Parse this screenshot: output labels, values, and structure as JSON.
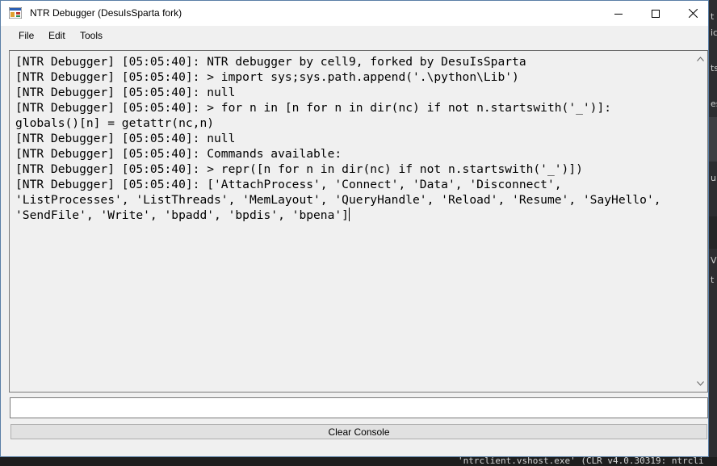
{
  "window": {
    "title": "NTR Debugger (DesuIsSparta fork)",
    "accent": "#5a7fa6"
  },
  "menu": {
    "items": [
      "File",
      "Edit",
      "Tools"
    ]
  },
  "console": {
    "text": "[NTR Debugger] [05:05:40]: NTR debugger by cell9, forked by DesuIsSparta\n[NTR Debugger] [05:05:40]: > import sys;sys.path.append('.\\python\\Lib')\n[NTR Debugger] [05:05:40]: null\n[NTR Debugger] [05:05:40]: > for n in [n for n in dir(nc) if not n.startswith('_')]:\nglobals()[n] = getattr(nc,n)\n[NTR Debugger] [05:05:40]: null\n[NTR Debugger] [05:05:40]: Commands available:\n[NTR Debugger] [05:05:40]: > repr([n for n in dir(nc) if not n.startswith('_')])\n[NTR Debugger] [05:05:40]: ['AttachProcess', 'Connect', 'Data', 'Disconnect',\n'ListProcesses', 'ListThreads', 'MemLayout', 'QueryHandle', 'Reload', 'Resume', 'SayHello',\n'SendFile', 'Write', 'bpadd', 'bpdis', 'bpena']"
  },
  "command_input": {
    "value": ""
  },
  "buttons": {
    "clear_console": "Clear Console"
  },
  "background": {
    "right_fragments": [
      "t",
      "ic",
      "ts",
      "es",
      "u",
      "V",
      "t"
    ],
    "bottom_text": "'ntrclient.vshost.exe' (CLR v4.0.30319: ntrcli"
  }
}
